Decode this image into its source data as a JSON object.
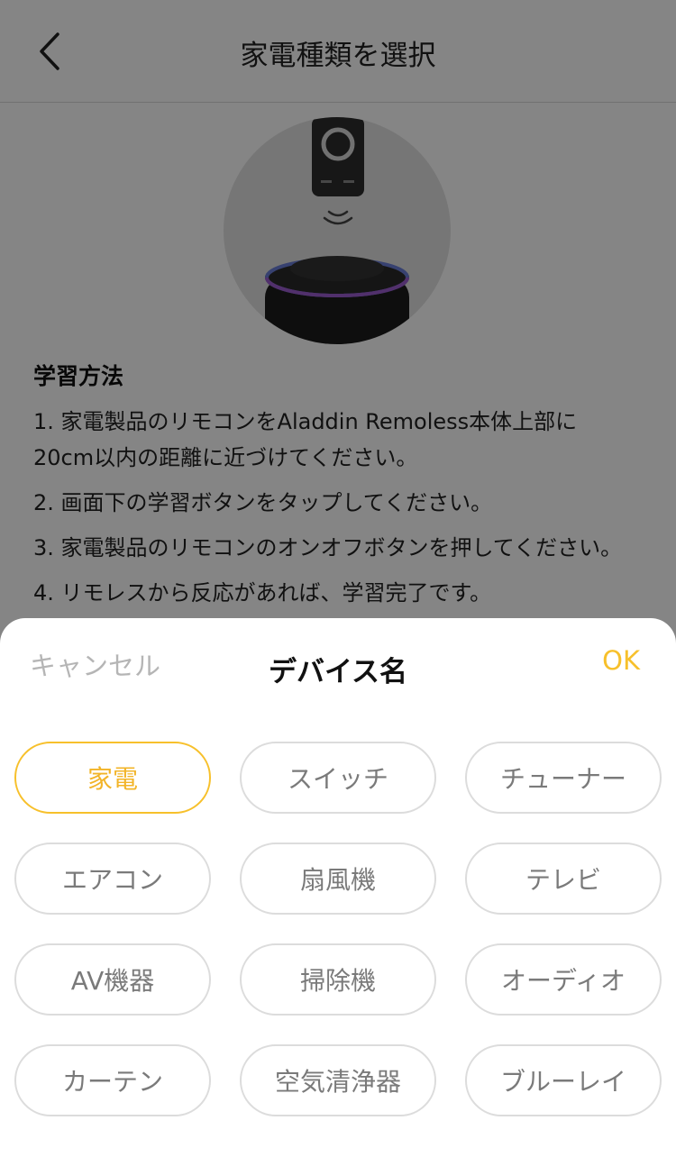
{
  "nav": {
    "title": "家電種類を選択"
  },
  "instructions": {
    "heading": "学習方法",
    "steps": [
      "1. 家電製品のリモコンをAladdin Remoless本体上部に20cm以内の距離に近づけてください。",
      "2. 画面下の学習ボタンをタップしてください。",
      "3. 家電製品のリモコンのオンオフボタンを押してください。",
      "4. リモレスから反応があれば、学習完了です。"
    ]
  },
  "sheet": {
    "cancel_label": "キャンセル",
    "title": "デバイス名",
    "ok_label": "OK",
    "options": [
      {
        "label": "家電",
        "selected": true
      },
      {
        "label": "スイッチ",
        "selected": false
      },
      {
        "label": "チューナー",
        "selected": false
      },
      {
        "label": "エアコン",
        "selected": false
      },
      {
        "label": "扇風機",
        "selected": false
      },
      {
        "label": "テレビ",
        "selected": false
      },
      {
        "label": "AV機器",
        "selected": false
      },
      {
        "label": "掃除機",
        "selected": false
      },
      {
        "label": "オーディオ",
        "selected": false
      },
      {
        "label": "カーテン",
        "selected": false
      },
      {
        "label": "空気清浄器",
        "selected": false
      },
      {
        "label": "ブルーレイ",
        "selected": false
      }
    ]
  },
  "colors": {
    "accent": "#f7c02b",
    "chip_border": "#dcdcdc",
    "chip_text": "#7a7a7a",
    "cancel_text": "#b5b5b5"
  }
}
